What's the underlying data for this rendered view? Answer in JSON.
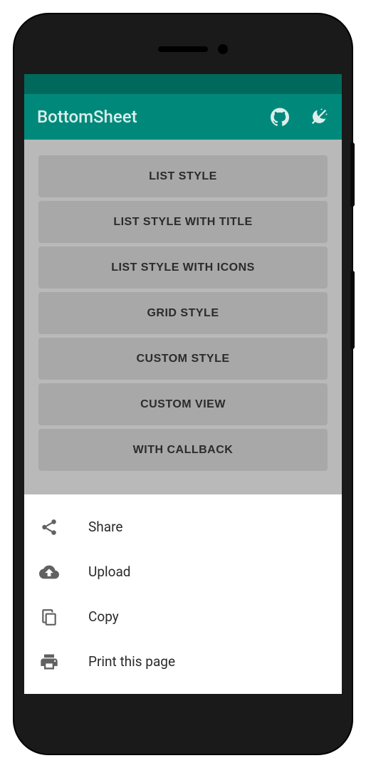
{
  "appbar": {
    "title": "BottomSheet"
  },
  "buttons": [
    {
      "label": "LIST STYLE"
    },
    {
      "label": "LIST STYLE WITH TITLE"
    },
    {
      "label": "LIST STYLE WITH ICONS"
    },
    {
      "label": "GRID STYLE"
    },
    {
      "label": "CUSTOM STYLE"
    },
    {
      "label": "CUSTOM VIEW"
    },
    {
      "label": "WITH CALLBACK"
    }
  ],
  "sheet": {
    "items": [
      {
        "icon": "share-icon",
        "label": "Share"
      },
      {
        "icon": "upload-icon",
        "label": "Upload"
      },
      {
        "icon": "copy-icon",
        "label": "Copy"
      },
      {
        "icon": "print-icon",
        "label": "Print this page"
      }
    ]
  }
}
